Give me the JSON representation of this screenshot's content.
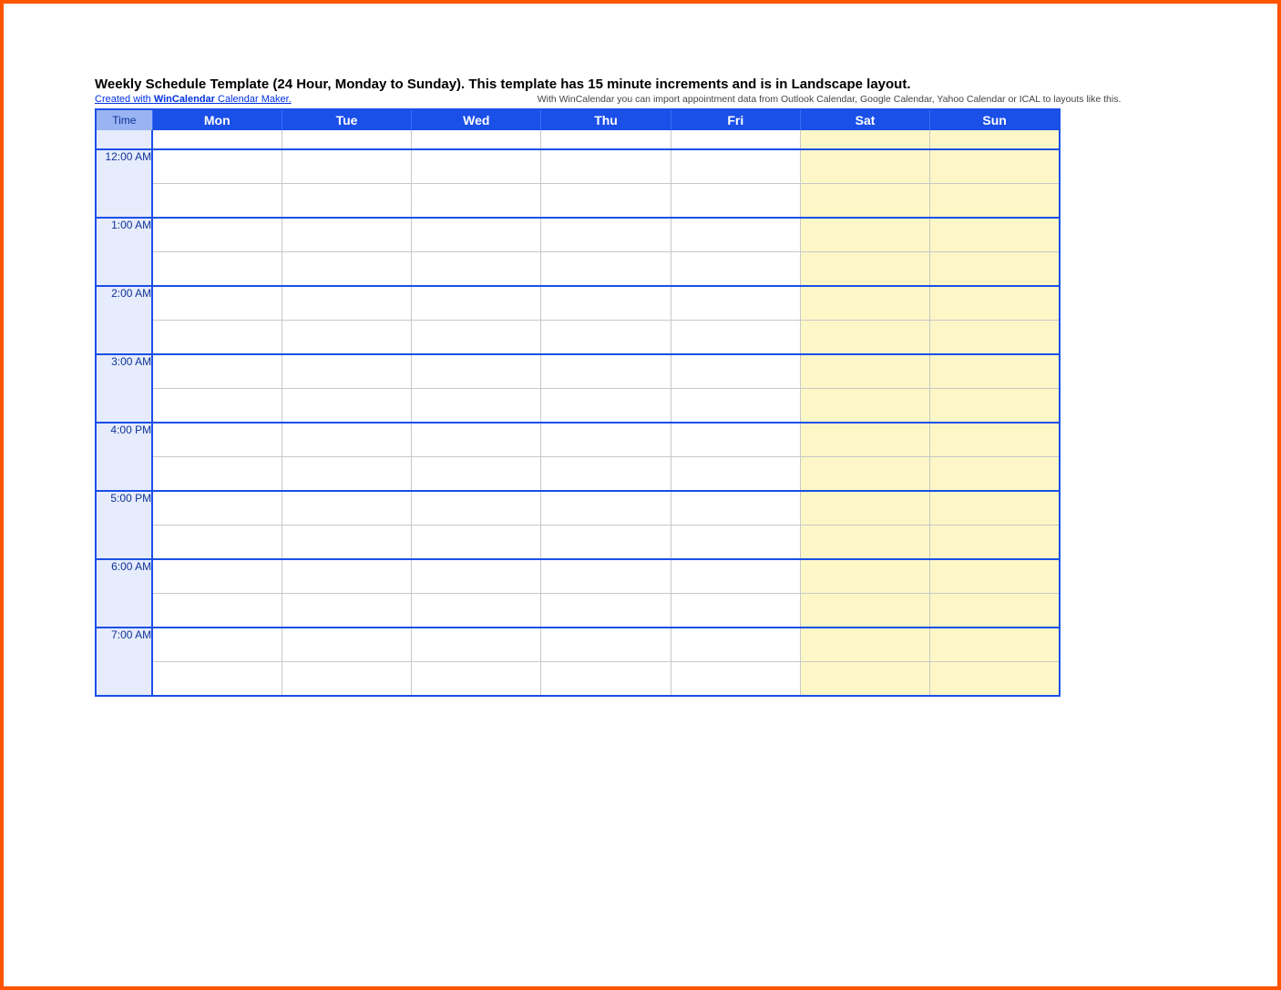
{
  "title": "Weekly Schedule Template (24 Hour, Monday to Sunday).  This template has 15 minute increments and is in Landscape layout.",
  "link": {
    "prefix": "Created with ",
    "brand": "WinCalendar",
    "suffix": " Calendar Maker."
  },
  "description": "With WinCalendar you can import appointment data from Outlook Calendar, Google Calendar, Yahoo Calendar or ICAL to layouts like this.",
  "header": {
    "time": "Time",
    "days": [
      "Mon",
      "Tue",
      "Wed",
      "Thu",
      "Fri",
      "Sat",
      "Sun"
    ]
  },
  "weekend_indices": [
    5,
    6
  ],
  "times": [
    "12:00 AM",
    "1:00 AM",
    "2:00 AM",
    "3:00 AM",
    "4:00 PM",
    "5:00 PM",
    "6:00 AM",
    "7:00 AM"
  ]
}
